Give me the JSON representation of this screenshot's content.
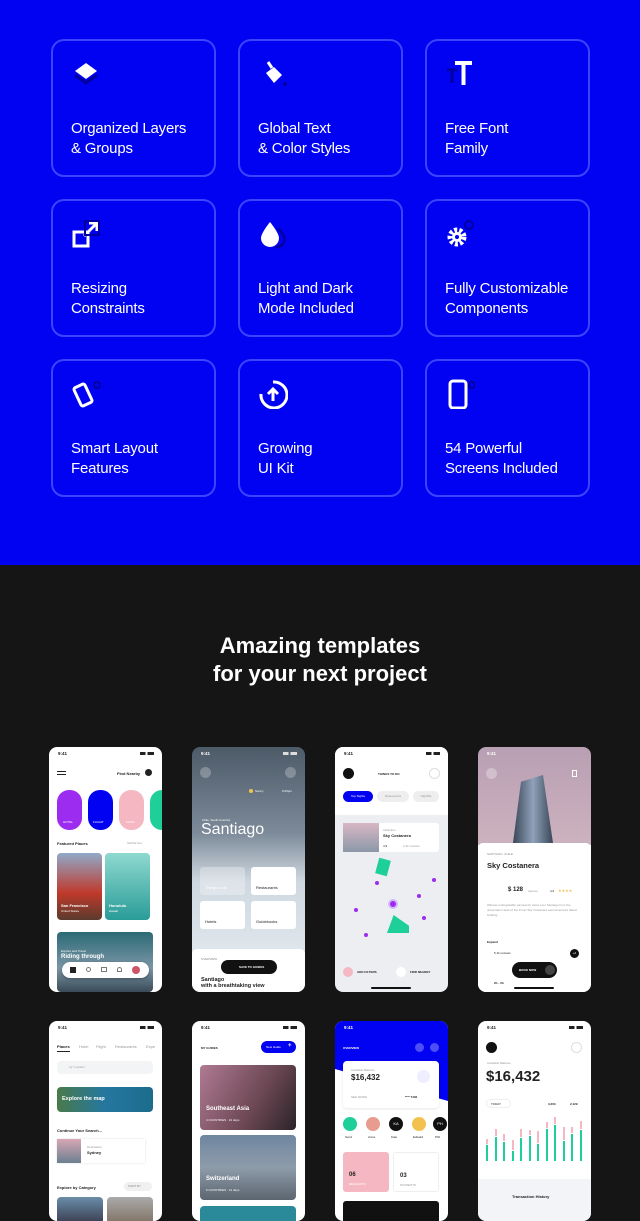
{
  "colors": {
    "brand_blue": "#0202f2",
    "card_border": "#3a45ff",
    "dark_bg": "#151515",
    "green": "#1fcf9a",
    "pink": "#f5b8c2",
    "purple": "#9b2cf0"
  },
  "features": [
    {
      "icon": "layers-icon",
      "label": "Organized Layers\n& Groups"
    },
    {
      "icon": "paint-bucket-icon",
      "label": "Global Text\n& Color Styles"
    },
    {
      "icon": "text-size-icon",
      "label": "Free Font\nFamily"
    },
    {
      "icon": "resize-icon",
      "label": "Resizing\nConstraints"
    },
    {
      "icon": "drop-icon",
      "label": "Light and Dark\nMode Included"
    },
    {
      "icon": "gear-icon",
      "label": "Fully Customizable\nComponents"
    },
    {
      "icon": "phone-rotate-icon",
      "label": "Smart Layout\nFeatures"
    },
    {
      "icon": "arrow-up-circle-icon",
      "label": "Growing\nUI Kit"
    },
    {
      "icon": "phone-icon",
      "label": "54 Powerful\nScreens Included"
    }
  ],
  "heading": "Amazing templates\nfor your next project",
  "status_time": "9:41",
  "screens": {
    "home": {
      "find_nearby": "Find Nearby",
      "categories": [
        "HOTEL",
        "FLIGHT",
        "FOOD"
      ],
      "featured": "Featured Places",
      "show_all": "SHOW ALL",
      "places": [
        {
          "name": "San Francisco",
          "country": "United States"
        },
        {
          "name": "Honolulu",
          "country": "Hawaii"
        }
      ],
      "banner_sub": "Explore and Travel",
      "banner_title": "Riding through"
    },
    "city": {
      "weather": "Sunny",
      "time": "6:00pm",
      "region": "Chile, South America",
      "title": "Santiago",
      "tiles": [
        "Things to do",
        "Restaurants",
        "Hotels",
        "Guidebooks"
      ],
      "overview": "OVERVIEW",
      "overview_title": "Santiago\nwith a breathtaking view",
      "save": "SAVE TO GUIDES"
    },
    "map": {
      "title": "THINGS TO DO",
      "chips": [
        "Top Sights",
        "Restaurants",
        "Nightlife"
      ],
      "card_type": "Attraction",
      "card_name": "Sky Costanera",
      "rating": "4.9",
      "reviews": "2.1k reviews",
      "add_filters": "ADD FILTERS",
      "find_nearby": "FIND NEARBY"
    },
    "detail": {
      "location": "SANTIAGO, CHILE",
      "name": "Sky Costanera",
      "price": "$ 128",
      "price_unit": "/person",
      "rating": "4.0",
      "description": "Witness unforgettable panoramic views over Santiago from the observation deck of the iconic Sky Costanera Latin America's tallest building.",
      "expand": "Expand",
      "reviews": "5.1k reviews",
      "more_avatars": "+2",
      "duration": "2h - 3h",
      "book": "BOOK NOW"
    },
    "search": {
      "tabs": [
        "Places",
        "Hotel",
        "Flight",
        "Restaurants",
        "Expe"
      ],
      "placeholder": "try \"London\"",
      "explore_map": "Explore the map",
      "continue": "Continue Your Search...",
      "dest_label": "Destination",
      "dest": "Sydney",
      "category": "Explore by Category",
      "sort": "SORT BY"
    },
    "guides": {
      "title": "MY GUIDES",
      "new_guide": "New Guide",
      "items": [
        {
          "name": "Southeast Asia",
          "meta": "4 COUNTRIES · 10 days"
        },
        {
          "name": "Switzerland",
          "meta": "6 COUNTRIES · 12 days"
        }
      ]
    },
    "wallet": {
      "title": "OVERVIEW",
      "balance_label": "Available Balance",
      "balance": "$16,432",
      "see_more": "SEE MORE",
      "card": "**** 7432",
      "contacts": [
        {
          "name": "Send",
          "initials": ""
        },
        {
          "name": "Anna",
          "initials": ""
        },
        {
          "name": "Kate",
          "initials": "KA"
        },
        {
          "name": "Edward",
          "initials": ""
        },
        {
          "name": "Phil",
          "initials": "PH"
        }
      ],
      "requests_count": "06",
      "requests": "REQUESTS",
      "payments_count": "03",
      "payments": "PAYMENTS"
    },
    "stats": {
      "balance_label": "Available Balance",
      "balance": "$16,432",
      "period": "TODAY",
      "income": "3,203",
      "expense": "2,129",
      "bars": [
        [
          40,
          12
        ],
        [
          60,
          18
        ],
        [
          48,
          16
        ],
        [
          26,
          24
        ],
        [
          58,
          20
        ],
        [
          62,
          14
        ],
        [
          42,
          30
        ],
        [
          80,
          14
        ],
        [
          90,
          18
        ],
        [
          50,
          32
        ],
        [
          68,
          14
        ],
        [
          78,
          20
        ]
      ],
      "history": "Transaction History"
    }
  }
}
